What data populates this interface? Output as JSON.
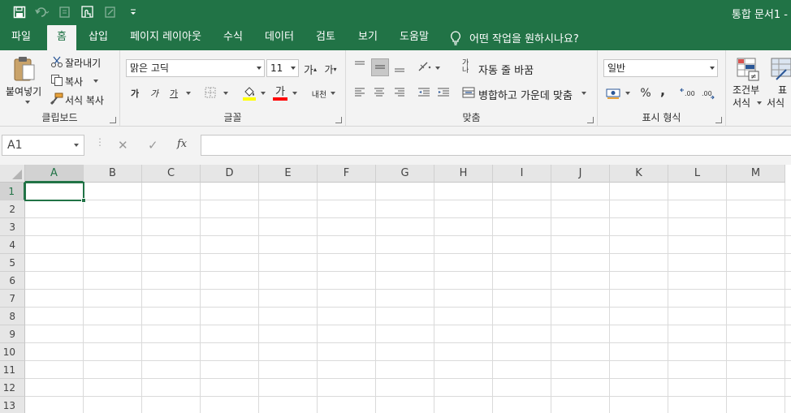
{
  "title": "통합 문서1 -",
  "tabs": [
    "파일",
    "홈",
    "삽입",
    "페이지 레이아웃",
    "수식",
    "데이터",
    "검토",
    "보기",
    "도움말"
  ],
  "active_tab": "홈",
  "tell_me": "어떤 작업을 원하시나요?",
  "clipboard": {
    "paste": "붙여넣기",
    "cut": "잘라내기",
    "copy": "복사",
    "format_painter": "서식 복사",
    "label": "클립보드"
  },
  "font": {
    "name": "맑은 고딕",
    "size": "11",
    "bold": "가",
    "italic": "가",
    "underline": "가",
    "grow": "가",
    "shrink": "가",
    "font_color_letter": "가",
    "phonetic": "내천",
    "label": "글꼴",
    "highlight_color": "#FFFF00",
    "font_color": "#FF0000"
  },
  "alignment": {
    "wrap": "자동 줄 바꿈",
    "wrap_icon_text": "가나",
    "merge": "병합하고 가운데 맞춤",
    "label": "맞춤"
  },
  "number": {
    "format": "일반",
    "percent": "%",
    "comma": ",",
    "label": "표시 형식"
  },
  "styles": {
    "conditional_1": "조건부",
    "conditional_2": "서식",
    "table_1": "표",
    "table_2": "서식"
  },
  "namebox": "A1",
  "fx": "fx",
  "columns": [
    "A",
    "B",
    "C",
    "D",
    "E",
    "F",
    "G",
    "H",
    "I",
    "J",
    "K",
    "L",
    "M"
  ],
  "rows": [
    "1",
    "2",
    "3",
    "4",
    "5",
    "6",
    "7",
    "8",
    "9",
    "10",
    "11",
    "12",
    "13"
  ],
  "active_cell": "A1",
  "colors": {
    "accent": "#217346"
  }
}
